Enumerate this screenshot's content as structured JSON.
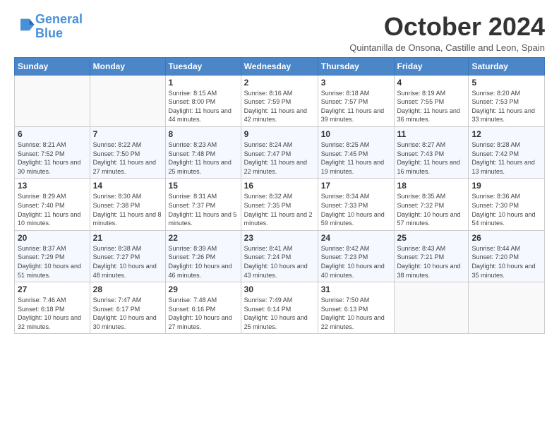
{
  "header": {
    "logo_general": "General",
    "logo_blue": "Blue",
    "month_year": "October 2024",
    "location": "Quintanilla de Onsona, Castille and Leon, Spain"
  },
  "days_of_week": [
    "Sunday",
    "Monday",
    "Tuesday",
    "Wednesday",
    "Thursday",
    "Friday",
    "Saturday"
  ],
  "weeks": [
    [
      {
        "num": "",
        "info": ""
      },
      {
        "num": "",
        "info": ""
      },
      {
        "num": "1",
        "info": "Sunrise: 8:15 AM\nSunset: 8:00 PM\nDaylight: 11 hours and 44 minutes."
      },
      {
        "num": "2",
        "info": "Sunrise: 8:16 AM\nSunset: 7:59 PM\nDaylight: 11 hours and 42 minutes."
      },
      {
        "num": "3",
        "info": "Sunrise: 8:18 AM\nSunset: 7:57 PM\nDaylight: 11 hours and 39 minutes."
      },
      {
        "num": "4",
        "info": "Sunrise: 8:19 AM\nSunset: 7:55 PM\nDaylight: 11 hours and 36 minutes."
      },
      {
        "num": "5",
        "info": "Sunrise: 8:20 AM\nSunset: 7:53 PM\nDaylight: 11 hours and 33 minutes."
      }
    ],
    [
      {
        "num": "6",
        "info": "Sunrise: 8:21 AM\nSunset: 7:52 PM\nDaylight: 11 hours and 30 minutes."
      },
      {
        "num": "7",
        "info": "Sunrise: 8:22 AM\nSunset: 7:50 PM\nDaylight: 11 hours and 27 minutes."
      },
      {
        "num": "8",
        "info": "Sunrise: 8:23 AM\nSunset: 7:48 PM\nDaylight: 11 hours and 25 minutes."
      },
      {
        "num": "9",
        "info": "Sunrise: 8:24 AM\nSunset: 7:47 PM\nDaylight: 11 hours and 22 minutes."
      },
      {
        "num": "10",
        "info": "Sunrise: 8:25 AM\nSunset: 7:45 PM\nDaylight: 11 hours and 19 minutes."
      },
      {
        "num": "11",
        "info": "Sunrise: 8:27 AM\nSunset: 7:43 PM\nDaylight: 11 hours and 16 minutes."
      },
      {
        "num": "12",
        "info": "Sunrise: 8:28 AM\nSunset: 7:42 PM\nDaylight: 11 hours and 13 minutes."
      }
    ],
    [
      {
        "num": "13",
        "info": "Sunrise: 8:29 AM\nSunset: 7:40 PM\nDaylight: 11 hours and 10 minutes."
      },
      {
        "num": "14",
        "info": "Sunrise: 8:30 AM\nSunset: 7:38 PM\nDaylight: 11 hours and 8 minutes."
      },
      {
        "num": "15",
        "info": "Sunrise: 8:31 AM\nSunset: 7:37 PM\nDaylight: 11 hours and 5 minutes."
      },
      {
        "num": "16",
        "info": "Sunrise: 8:32 AM\nSunset: 7:35 PM\nDaylight: 11 hours and 2 minutes."
      },
      {
        "num": "17",
        "info": "Sunrise: 8:34 AM\nSunset: 7:33 PM\nDaylight: 10 hours and 59 minutes."
      },
      {
        "num": "18",
        "info": "Sunrise: 8:35 AM\nSunset: 7:32 PM\nDaylight: 10 hours and 57 minutes."
      },
      {
        "num": "19",
        "info": "Sunrise: 8:36 AM\nSunset: 7:30 PM\nDaylight: 10 hours and 54 minutes."
      }
    ],
    [
      {
        "num": "20",
        "info": "Sunrise: 8:37 AM\nSunset: 7:29 PM\nDaylight: 10 hours and 51 minutes."
      },
      {
        "num": "21",
        "info": "Sunrise: 8:38 AM\nSunset: 7:27 PM\nDaylight: 10 hours and 48 minutes."
      },
      {
        "num": "22",
        "info": "Sunrise: 8:39 AM\nSunset: 7:26 PM\nDaylight: 10 hours and 46 minutes."
      },
      {
        "num": "23",
        "info": "Sunrise: 8:41 AM\nSunset: 7:24 PM\nDaylight: 10 hours and 43 minutes."
      },
      {
        "num": "24",
        "info": "Sunrise: 8:42 AM\nSunset: 7:23 PM\nDaylight: 10 hours and 40 minutes."
      },
      {
        "num": "25",
        "info": "Sunrise: 8:43 AM\nSunset: 7:21 PM\nDaylight: 10 hours and 38 minutes."
      },
      {
        "num": "26",
        "info": "Sunrise: 8:44 AM\nSunset: 7:20 PM\nDaylight: 10 hours and 35 minutes."
      }
    ],
    [
      {
        "num": "27",
        "info": "Sunrise: 7:46 AM\nSunset: 6:18 PM\nDaylight: 10 hours and 32 minutes."
      },
      {
        "num": "28",
        "info": "Sunrise: 7:47 AM\nSunset: 6:17 PM\nDaylight: 10 hours and 30 minutes."
      },
      {
        "num": "29",
        "info": "Sunrise: 7:48 AM\nSunset: 6:16 PM\nDaylight: 10 hours and 27 minutes."
      },
      {
        "num": "30",
        "info": "Sunrise: 7:49 AM\nSunset: 6:14 PM\nDaylight: 10 hours and 25 minutes."
      },
      {
        "num": "31",
        "info": "Sunrise: 7:50 AM\nSunset: 6:13 PM\nDaylight: 10 hours and 22 minutes."
      },
      {
        "num": "",
        "info": ""
      },
      {
        "num": "",
        "info": ""
      }
    ]
  ]
}
